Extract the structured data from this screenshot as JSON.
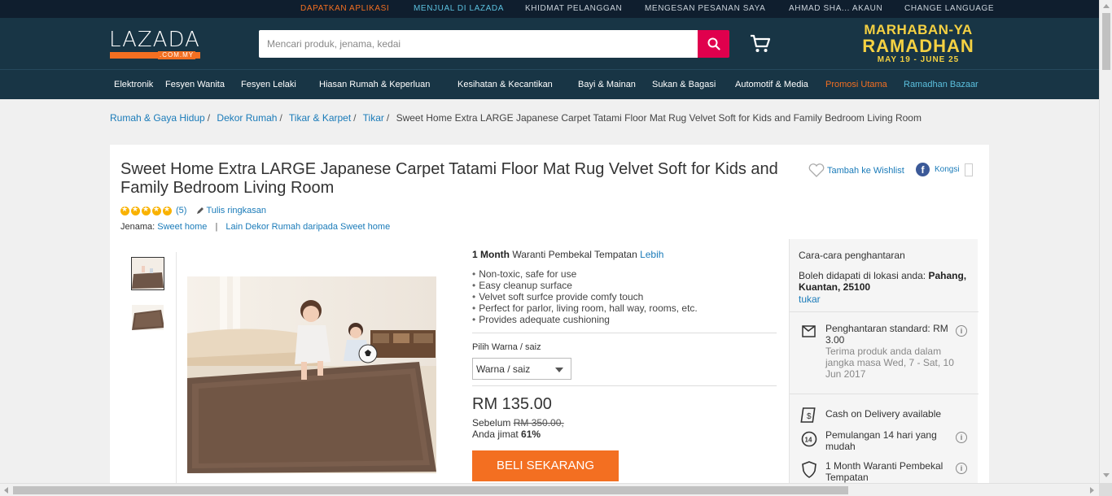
{
  "topbar": {
    "links": [
      {
        "label": "DAPATKAN APLIKASI",
        "color": "#f36f21"
      },
      {
        "label": "MENJUAL DI LAZADA",
        "color": "#5bc0de"
      },
      {
        "label": "KHIDMAT PELANGGAN",
        "color": "#c9d1d9"
      },
      {
        "label": "MENGESAN PESANAN SAYA",
        "color": "#c9d1d9"
      },
      {
        "label": "AHMAD SHA... AKAUN",
        "color": "#c9d1d9"
      },
      {
        "label": "CHANGE LANGUAGE",
        "color": "#c9d1d9"
      }
    ]
  },
  "header": {
    "logo_word": "LAZADA",
    "logo_domain": ".COM.MY",
    "search_placeholder": "Mencari produk, jenama, kedai",
    "search_icon": "search-icon",
    "cart_icon": "cart-icon",
    "promo": {
      "line1": "MARHABAN-YA",
      "line2": "RAMADHAN",
      "line3": "MAY 19 - JUNE 25"
    }
  },
  "categories": [
    {
      "label": "Elektronik",
      "color": "#ffffff"
    },
    {
      "label": "Fesyen Wanita",
      "color": "#ffffff"
    },
    {
      "label": "Fesyen Lelaki",
      "color": "#ffffff"
    },
    {
      "label": "Hiasan Rumah & Keperluan",
      "color": "#ffffff"
    },
    {
      "label": "Kesihatan & Kecantikan",
      "color": "#ffffff"
    },
    {
      "label": "Bayi & Mainan",
      "color": "#ffffff"
    },
    {
      "label": "Sukan & Bagasi",
      "color": "#ffffff"
    },
    {
      "label": "Automotif & Media",
      "color": "#ffffff"
    },
    {
      "label": "Promosi Utama",
      "color": "#f36f21"
    },
    {
      "label": "Ramadhan Bazaar",
      "color": "#5bc0de"
    }
  ],
  "breadcrumb": {
    "links": [
      "Rumah & Gaya Hidup",
      "Dekor Rumah",
      "Tikar & Karpet",
      "Tikar"
    ],
    "current": "Sweet Home Extra LARGE Japanese Carpet Tatami Floor Mat Rug Velvet Soft for Kids and Family Bedroom Living Room"
  },
  "product": {
    "title": "Sweet Home Extra LARGE Japanese Carpet Tatami Floor Mat Rug Velvet Soft for Kids and Family Bedroom Living Room",
    "rating_count": "(5)",
    "write_review": "Tulis ringkasan",
    "brand_label": "Jenama:",
    "brand_name": "Sweet home",
    "brand_more": "Lain Dekor Rumah daripada Sweet home",
    "wishlist": "Tambah ke Wishlist",
    "share": "Kongsi",
    "warranty_bold": "1 Month",
    "warranty_text": " Waranti Pembekal Tempatan ",
    "warranty_link": "Lebih",
    "features": [
      "Non-toxic, safe for use",
      "Easy cleanup surface",
      "Velvet soft surfce provide comfy touch",
      "Perfect for parlor, living room, hall way, rooms, etc.",
      "Provides adequate cushioning"
    ],
    "variant_label": "Pilih Warna / saiz",
    "variant_value": "Warna / saiz",
    "price": "RM 135.00",
    "before_label": "Sebelum ",
    "before_price": "RM 350.00,",
    "save_label": "Anda jimat ",
    "save_pct": "61%",
    "buy_label": "BELI SEKARANG"
  },
  "delivery": {
    "heading": "Cara-cara penghantaran",
    "location_label": "Boleh didapati di lokasi anda: ",
    "location": "Pahang, Kuantan, 25100",
    "change": "tukar",
    "standard_title": "Penghantaran standard: RM 3.00",
    "standard_sub": "Terima produk anda dalam jangka masa Wed, 7 - Sat, 10 Jun 2017",
    "cod": "Cash on Delivery available",
    "return": "Pemulangan 14 hari yang mudah",
    "warranty": "1 Month Waranti Pembekal Tempatan"
  }
}
